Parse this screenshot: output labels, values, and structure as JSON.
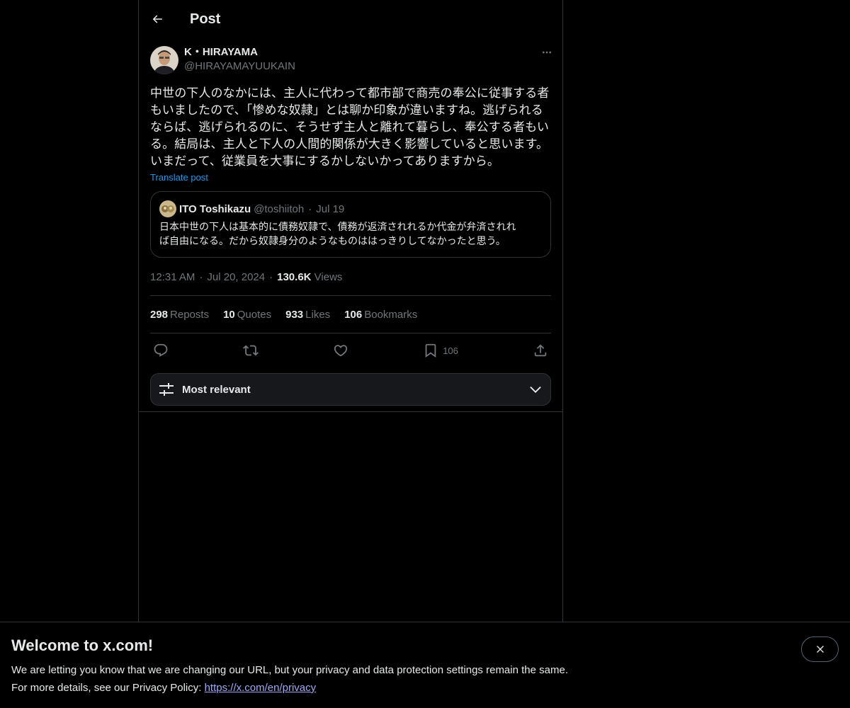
{
  "header": {
    "title": "Post",
    "back_icon": "arrow-left-icon"
  },
  "post": {
    "author_name": "K・HIRAYAMA",
    "author_handle": "@HIRAYAMAYUUKAIN",
    "text": "中世の下人のなかには、主人に代わって都市部で商売の奉公に従事する者\nもいましたので、「惨めな奴隷」とは聊か印象が違いますね。逃げられる\nならば、逃げられるのに、そうせず主人と離れて暮らし、奉公する者もい\nる。結局は、主人と下人の人間的関係が大きく影響していると思います。\nいまだって、従業員を大事にするかしないかってありますから。",
    "translate_label": "Translate post",
    "time": "12:31 AM",
    "date": "Jul 20, 2024",
    "views_count": "130.6K",
    "views_label": "Views"
  },
  "quote": {
    "author_name": "ITO Toshikazu",
    "author_handle": "@toshiitoh",
    "date": "Jul 19",
    "text": "日本中世の下人は基本的に債務奴隷で、債務が返済されれるか代金が弁済されれ\nば自由になる。だから奴隷身分のようなものははっきりしてなかったと思う。"
  },
  "stats": {
    "reposts_count": "298",
    "reposts_label": "Reposts",
    "quotes_count": "10",
    "quotes_label": "Quotes",
    "likes_count": "933",
    "likes_label": "Likes",
    "bookmarks_count": "106",
    "bookmarks_label": "Bookmarks"
  },
  "actions": {
    "bookmark_count": "106"
  },
  "sort": {
    "label": "Most relevant"
  },
  "banner": {
    "title": "Welcome to x.com!",
    "line1": "We are letting you know that we are changing our URL, but your privacy and data protection settings remain the same.",
    "line2_prefix": "For more details, see our Privacy Policy: ",
    "link": "https://x.com/en/privacy"
  },
  "colors": {
    "accent": "#1d9bf0",
    "background": "#000000",
    "muted": "#71767b",
    "border": "#2f3336"
  }
}
